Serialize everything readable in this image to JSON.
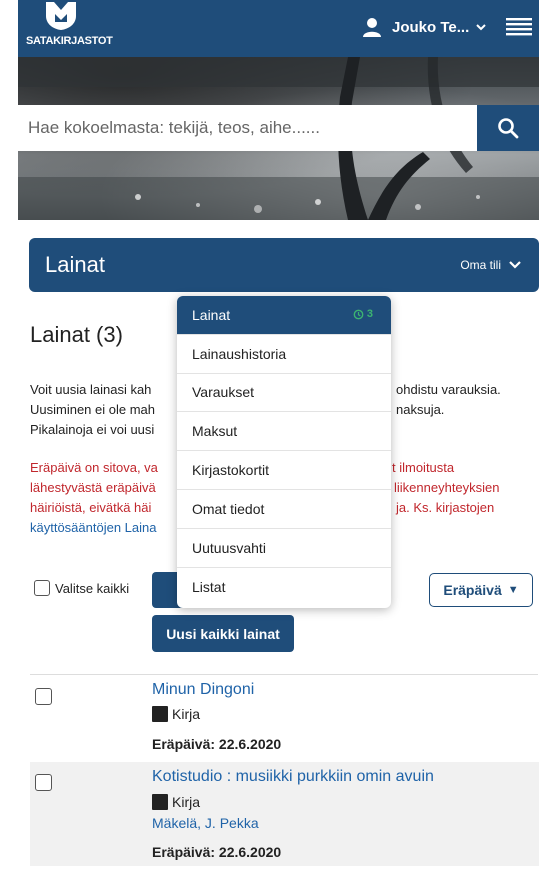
{
  "header": {
    "logo_text": "SATAKIRJASTOT",
    "user_name": "Jouko Te...",
    "icons": [
      "person-icon",
      "chevron-down-icon",
      "hamburger-menu-icon"
    ]
  },
  "search": {
    "placeholder": "Hae kokoelmasta: tekijä, teos, aihe......",
    "icon": "search-icon"
  },
  "section": {
    "title": "Lainat",
    "account_label": "Oma tili"
  },
  "page": {
    "heading": "Lainat (3)",
    "info_lines": [
      "Voit uusia lainasi kah",
      "ohdistu varauksia.",
      "Uusiminen ei ole mah",
      "naksuja.",
      "Pikalainoja ei voi uusi"
    ],
    "warning_lines": [
      "Eräpäivä on sitova, va",
      "t ilmoitusta",
      "lähestyvästä eräpäivä",
      "liikenneyhteyksien",
      "häiriöistä, eivätkä häi",
      "ja. Ks. kirjastojen",
      "käyttösääntöjen Laina"
    ]
  },
  "controls": {
    "select_all_label": "Valitse kaikki",
    "renew_selected_label": "U",
    "renew_all_label": "Uusi kaikki lainat",
    "sort_label": "Eräpäivä",
    "sort_icon": "triangle-down-icon"
  },
  "loans": [
    {
      "title": "Minun Dingoni",
      "type": "Kirja",
      "author": "",
      "due": "Eräpäivä: 22.6.2020"
    },
    {
      "title": "Kotistudio : musiikki purkkiin omin avuin",
      "type": "Kirja",
      "author": "Mäkelä, J. Pekka",
      "due": "Eräpäivä: 22.6.2020"
    }
  ],
  "dropdown": {
    "items": [
      {
        "label": "Lainat",
        "badge": "3",
        "active": true
      },
      {
        "label": "Lainaushistoria"
      },
      {
        "label": "Varaukset"
      },
      {
        "label": "Maksut"
      },
      {
        "label": "Kirjastokortit"
      },
      {
        "label": "Omat tiedot"
      },
      {
        "label": "Uutuusvahti"
      },
      {
        "label": "Listat"
      }
    ]
  },
  "colors": {
    "primary": "#1f4d7a",
    "link": "#1f63a8",
    "warning": "#c1272d",
    "badge": "#3cb371"
  }
}
